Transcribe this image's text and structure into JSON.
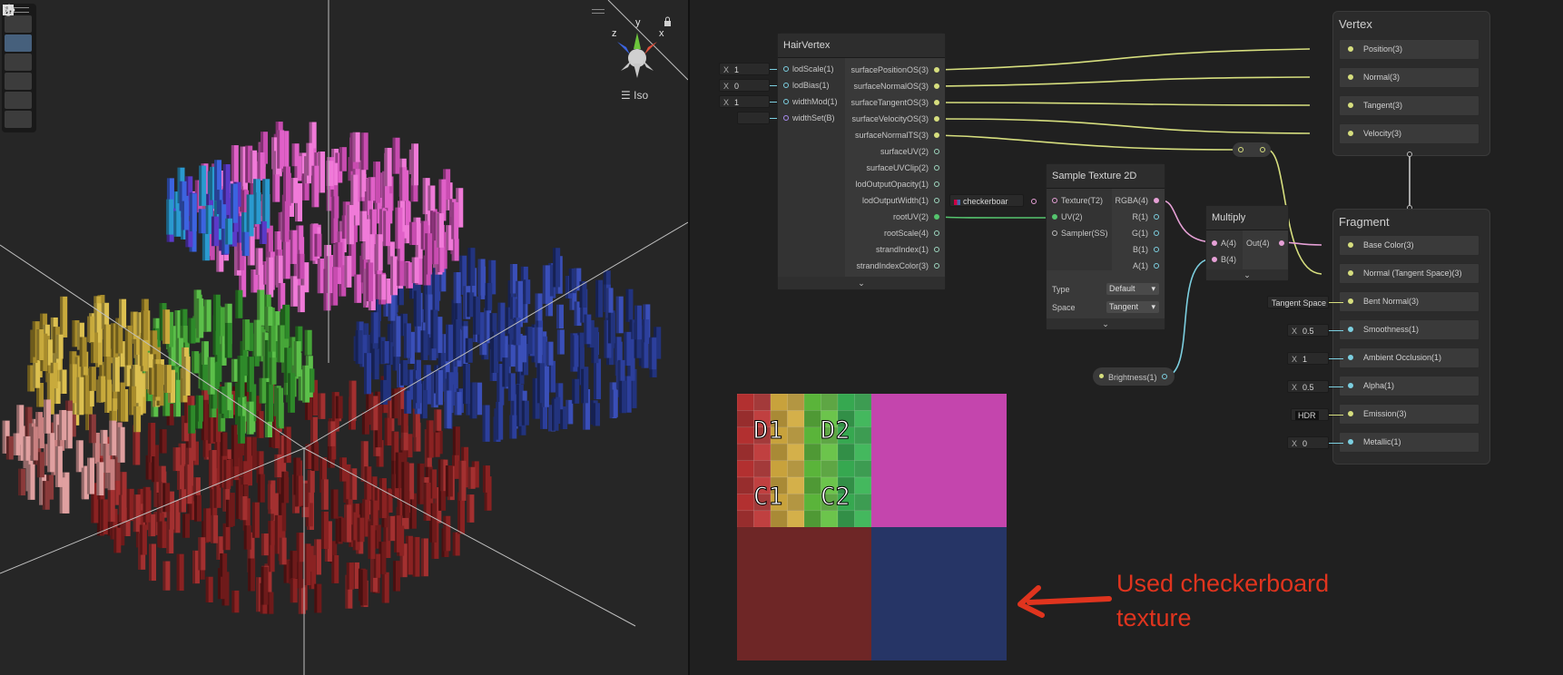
{
  "scene_view": {
    "projection_label": "Iso",
    "axis_labels": {
      "x": "x",
      "y": "y",
      "z": "z"
    },
    "tools": [
      "hand-icon",
      "move-icon",
      "rotate-icon",
      "scale-icon",
      "rect-icon",
      "transform-icon"
    ],
    "active_tool": "move-icon"
  },
  "hair_vertex": {
    "title": "HairVertex",
    "inputs": [
      {
        "label": "lodScale(1)",
        "field_prefix": "X",
        "value": "1"
      },
      {
        "label": "lodBias(1)",
        "field_prefix": "X",
        "value": "0"
      },
      {
        "label": "widthMod(1)",
        "field_prefix": "X",
        "value": "1"
      },
      {
        "label": "widthSet(B)",
        "field_prefix": "",
        "value": ""
      }
    ],
    "outputs": [
      "surfacePositionOS(3)",
      "surfaceNormalOS(3)",
      "surfaceTangentOS(3)",
      "surfaceVelocityOS(3)",
      "surfaceNormalTS(3)",
      "surfaceUV(2)",
      "surfaceUVClip(2)",
      "lodOutputOpacity(1)",
      "lodOutputWidth(1)",
      "rootUV(2)",
      "rootScale(4)",
      "strandIndex(1)",
      "strandIndexColor(3)"
    ]
  },
  "texture_property": {
    "label": "checkerboar"
  },
  "sample_texture": {
    "title": "Sample Texture 2D",
    "inputs": [
      "Texture(T2)",
      "UV(2)",
      "Sampler(SS)"
    ],
    "outputs": [
      "RGBA(4)",
      "R(1)",
      "G(1)",
      "B(1)",
      "A(1)"
    ],
    "type_label": "Type",
    "type_value": "Default",
    "space_label": "Space",
    "space_value": "Tangent"
  },
  "multiply": {
    "title": "Multiply",
    "inputs": [
      "A(4)",
      "B(4)"
    ],
    "output": "Out(4)"
  },
  "brightness": {
    "label": "Brightness(1)"
  },
  "vertex_block": {
    "title": "Vertex",
    "rows": [
      "Position(3)",
      "Normal(3)",
      "Tangent(3)",
      "Velocity(3)"
    ]
  },
  "fragment_block": {
    "title": "Fragment",
    "rows": [
      "Base Color(3)",
      "Normal (Tangent Space)(3)",
      "Bent Normal(3)",
      "Smoothness(1)",
      "Ambient Occlusion(1)",
      "Alpha(1)",
      "Emission(3)",
      "Metallic(1)"
    ],
    "inline_inputs": [
      {
        "row": 2,
        "prefix": "",
        "value": "Tangent Space"
      },
      {
        "row": 3,
        "prefix": "X",
        "value": "0.5"
      },
      {
        "row": 4,
        "prefix": "X",
        "value": "1"
      },
      {
        "row": 5,
        "prefix": "X",
        "value": "0.5"
      },
      {
        "row": 6,
        "prefix": "",
        "value": "HDR"
      },
      {
        "row": 7,
        "prefix": "X",
        "value": "0"
      }
    ]
  },
  "checkerboard": {
    "cells": [
      "D1",
      "D2",
      "C1",
      "C2"
    ]
  },
  "annotation": {
    "line1": "Used checkerboard",
    "line2": "texture"
  },
  "colors": {
    "pink": "#e060c8",
    "blue": "#2c3f9c",
    "red": "#8c2424",
    "green": "#46a638",
    "yellow": "#c8aa3c",
    "wire_vec3": "#d6de7e",
    "wire_vec4": "#e6a0d6",
    "wire_float": "#7ccfe0"
  }
}
